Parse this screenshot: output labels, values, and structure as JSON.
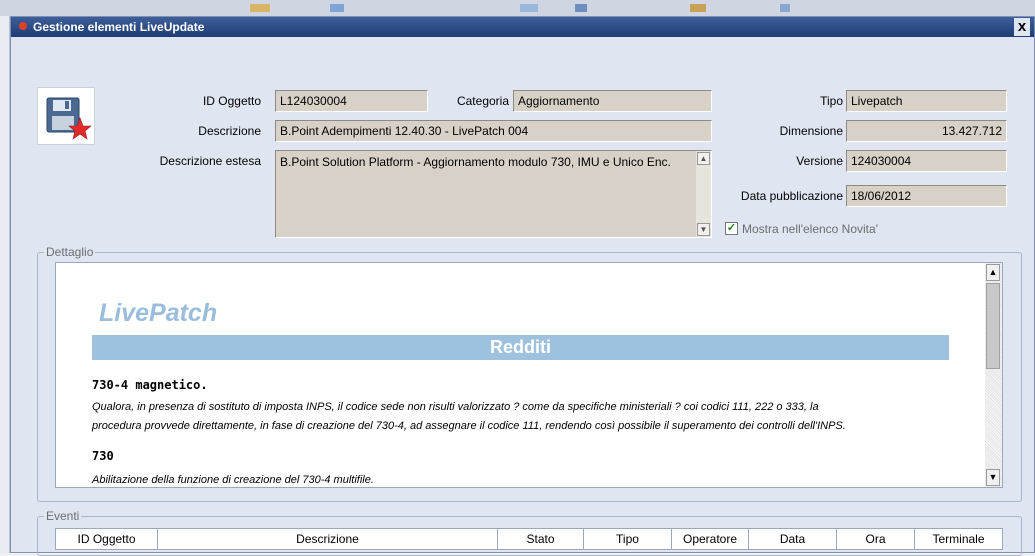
{
  "window": {
    "title": "Gestione elementi LiveUpdate",
    "close_glyph": "x"
  },
  "form": {
    "id_label": "ID Oggetto",
    "id_value": "L124030004",
    "categoria_label": "Categoria",
    "categoria_value": "Aggiornamento",
    "tipo_label": "Tipo",
    "tipo_value": "Livepatch",
    "descrizione_label": "Descrizione",
    "descrizione_value": "B.Point Adempimenti 12.40.30 - LivePatch 004",
    "dimensione_label": "Dimensione",
    "dimensione_value": "13.427.712",
    "estesa_label": "Descrizione estesa",
    "estesa_value": "B.Point Solution Platform -  Aggiornamento modulo 730, IMU e Unico Enc.",
    "versione_label": "Versione",
    "versione_value": "124030004",
    "data_label": "Data pubblicazione",
    "data_value": "18/06/2012",
    "checkbox_label": "Mostra nell'elenco Novita'",
    "checkbox_checked": true
  },
  "dettaglio": {
    "legend": "Dettaglio",
    "title": "LivePatch",
    "section": "Redditi",
    "h1": "730-4 magnetico.",
    "p1_line1": "Qualora, in presenza di sostituto di imposta INPS, il codice sede non risulti valorizzato ? come da specifiche ministeriali ? coi codici 111, 222 o 333, la",
    "p1_line2": "procedura provvede direttamente, in fase di creazione del 730-4, ad assegnare il codice 111, rendendo così possibile il superamento dei controlli dell'INPS.",
    "h2": "730",
    "p2": "Abilitazione della funzione di creazione del 730-4 multifile."
  },
  "eventi": {
    "legend": "Eventi",
    "columns": [
      "ID Oggetto",
      "Descrizione",
      "Stato",
      "Tipo",
      "Operatore",
      "Data",
      "Ora",
      "Terminale"
    ]
  },
  "icons": {
    "save": "save-floppy-star-icon",
    "app": "app-icon"
  },
  "colors": {
    "title_bar": "#1f3c74",
    "livepatch_title": "#9bbddc",
    "section_bar": "#9ec2de",
    "field_bg": "#d8d1c8"
  }
}
